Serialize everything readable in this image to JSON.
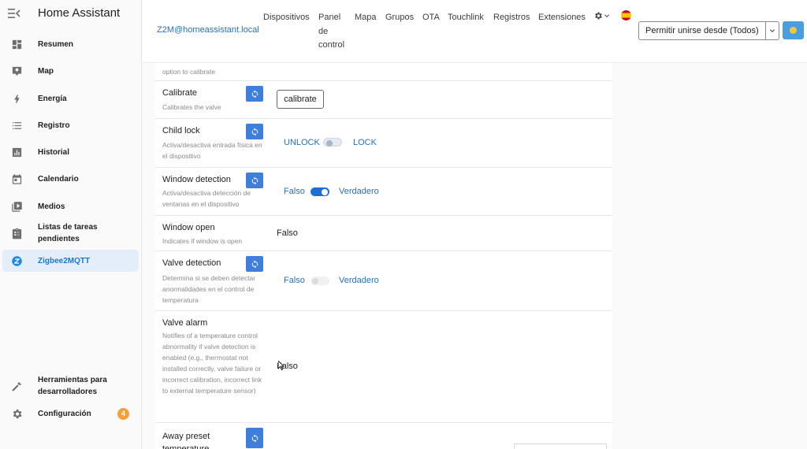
{
  "app": {
    "title": "Home Assistant"
  },
  "sidebar": {
    "items": [
      {
        "label": "Resumen",
        "icon": "dashboard-icon"
      },
      {
        "label": "Map",
        "icon": "map-icon"
      },
      {
        "label": "Energía",
        "icon": "lightning-icon"
      },
      {
        "label": "Registro",
        "icon": "list-icon"
      },
      {
        "label": "Historial",
        "icon": "chart-icon"
      },
      {
        "label": "Calendario",
        "icon": "calendar-icon"
      },
      {
        "label": "Medios",
        "icon": "media-icon"
      },
      {
        "label": "Listas de tareas pendientes",
        "icon": "clipboard-icon"
      },
      {
        "label": "Zigbee2MQTT",
        "icon": "zigbee-icon",
        "active": true
      }
    ],
    "dev_tools": "Herramientas para desarrolladores",
    "config": "Configuración",
    "config_badge": "4"
  },
  "topbar": {
    "link": "Z2M@homeassistant.local",
    "nav": [
      "Dispositivos",
      "Panel de control",
      "Mapa",
      "Grupos",
      "OTA",
      "Touchlink",
      "Registros",
      "Extensiones"
    ],
    "permit_join": "Permitir unirse desde (Todos)"
  },
  "rows": {
    "top_partial": {
      "desc": "option to calibrate"
    },
    "calibrate": {
      "title": "Calibrate",
      "desc": "Calibrates the valve",
      "button": "calibrate"
    },
    "child_lock": {
      "title": "Child lock",
      "desc": "Activa/desactiva entrada física en el dispositivo",
      "off": "UNLOCK",
      "on": "LOCK",
      "state": false
    },
    "window_detection": {
      "title": "Window detection",
      "desc": "Activa/desactiva detección de ventanas en el dispositivo",
      "off": "Falso",
      "on": "Verdadero",
      "state": true
    },
    "window_open": {
      "title": "Window open",
      "desc": "Indicates if window is open",
      "value": "Falso"
    },
    "valve_detection": {
      "title": "Valve detection",
      "desc": "Determina si se deben detectar anormalidades en el control de temperatura",
      "off": "Falso",
      "on": "Verdadero",
      "state": false
    },
    "valve_alarm": {
      "title": "Valve alarm",
      "desc": "Notifies of a temperature control abnormality if valve detection is enabled (e.g., thermostat not installed correctly, valve failure or incorrect calibration, incorrect link to external temperature sensor)",
      "value": "Falso"
    },
    "away_preset": {
      "title": "Away preset temperature"
    }
  }
}
